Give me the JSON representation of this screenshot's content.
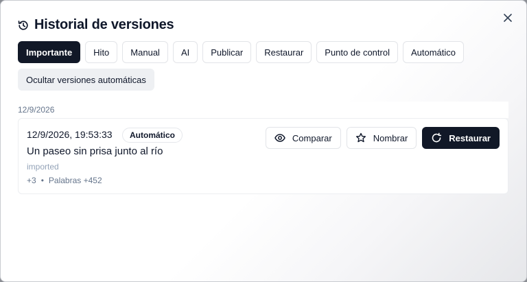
{
  "dialog": {
    "title": "Historial de versiones",
    "close_icon": "x-icon",
    "title_icon": "history-icon"
  },
  "filters": [
    {
      "label": "Importante",
      "active": true
    },
    {
      "label": "Hito",
      "active": false
    },
    {
      "label": "Manual",
      "active": false
    },
    {
      "label": "AI",
      "active": false
    },
    {
      "label": "Publicar",
      "active": false
    },
    {
      "label": "Restaurar",
      "active": false
    },
    {
      "label": "Punto de control",
      "active": false
    },
    {
      "label": "Automático",
      "active": false
    }
  ],
  "hide_auto_label": "Ocultar versiones automáticas",
  "groups": [
    {
      "date": "12/9/2026",
      "versions": [
        {
          "timestamp": "12/9/2026, 19:53:33",
          "badge": "Automático",
          "name": "Un paseo sin prisa junto al río",
          "source": "imported",
          "changes": "+3",
          "separator": "•",
          "words": "Palabras +452",
          "actions": {
            "compare": "Comparar",
            "name": "Nombrar",
            "restore": "Restaurar"
          }
        }
      ]
    }
  ],
  "colors": {
    "primary": "#111827",
    "muted": "#64748b",
    "border": "#e2e4e8"
  }
}
